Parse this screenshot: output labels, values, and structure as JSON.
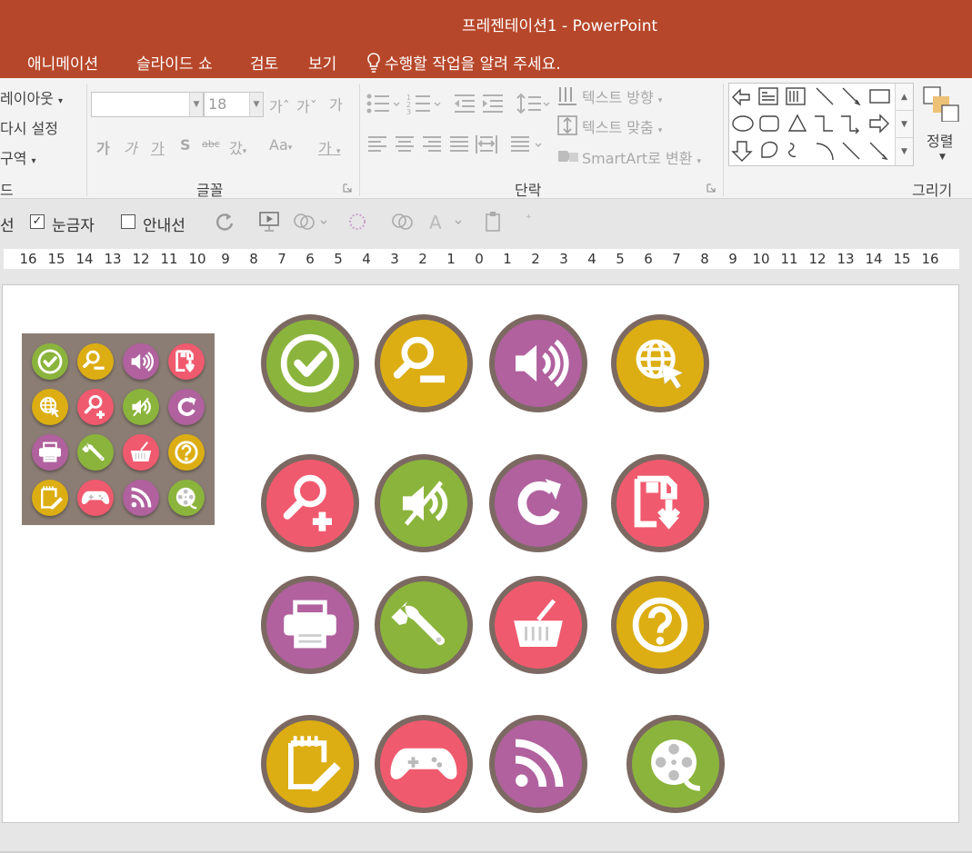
{
  "window": {
    "title": "프레젠테이션1  -  PowerPoint"
  },
  "tabs": [
    "애니메이션",
    "슬라이드 쇼",
    "검토",
    "보기"
  ],
  "tell_me": "수행할 작업을 알려 주세요.",
  "ribbon": {
    "slides_group": {
      "layout": "레이아웃",
      "reset": "다시 설정",
      "section": "구역",
      "label_fragment": "드"
    },
    "font_group": {
      "label": "글꼴",
      "font_name": "",
      "font_size": "18",
      "grow": "가ˆ",
      "shrink": "가ˇ",
      "clear": "가",
      "bold": "가",
      "italic": "가",
      "underline": "가",
      "shadow": "S",
      "strike": "abc",
      "spacing": "갔",
      "case": "Aa",
      "color": "가"
    },
    "paragraph_group": {
      "label": "단락",
      "text_direction": "텍스트 방향",
      "align_text": "텍스트 맞춤",
      "smartart": "SmartArt로 변환"
    },
    "drawing_group": {
      "label": "그리기",
      "arrange": "정렬"
    }
  },
  "view_toolbar": {
    "guides_fragment": "선",
    "gridlines": "눈금자",
    "guides": "안내선",
    "gridlines_checked": true,
    "guides_checked": false
  },
  "ruler": [
    "16",
    "15",
    "14",
    "13",
    "12",
    "11",
    "10",
    "9",
    "8",
    "7",
    "6",
    "5",
    "4",
    "3",
    "2",
    "1",
    "0",
    "1",
    "2",
    "3",
    "4",
    "5",
    "6",
    "7",
    "8",
    "9",
    "10",
    "11",
    "12",
    "13",
    "14",
    "15",
    "16"
  ],
  "colors": {
    "titlebar": "#b7472a",
    "green": "#8bb43c",
    "yellow": "#dcae13",
    "purple": "#b0619e",
    "pink": "#f05a6e",
    "ring": "#7b6962",
    "thumb_bg": "#8b7d74"
  },
  "thumbnail_icons": [
    {
      "icon": "check-icon",
      "color": "green"
    },
    {
      "icon": "zoom-out-icon",
      "color": "yellow"
    },
    {
      "icon": "volume-icon",
      "color": "purple"
    },
    {
      "icon": "save-download-icon",
      "color": "pink"
    },
    {
      "icon": "globe-cursor-icon",
      "color": "yellow"
    },
    {
      "icon": "zoom-in-icon",
      "color": "pink"
    },
    {
      "icon": "mute-icon",
      "color": "green"
    },
    {
      "icon": "refresh-icon",
      "color": "purple"
    },
    {
      "icon": "printer-icon",
      "color": "purple"
    },
    {
      "icon": "wrench-icon",
      "color": "green"
    },
    {
      "icon": "basket-icon",
      "color": "pink"
    },
    {
      "icon": "help-icon",
      "color": "yellow"
    },
    {
      "icon": "notepad-icon",
      "color": "yellow"
    },
    {
      "icon": "gamepad-icon",
      "color": "pink"
    },
    {
      "icon": "rss-icon",
      "color": "purple"
    },
    {
      "icon": "film-reel-icon",
      "color": "green"
    }
  ],
  "slide_icons": [
    {
      "icon": "check-icon",
      "color": "green"
    },
    {
      "icon": "zoom-out-icon",
      "color": "yellow"
    },
    {
      "icon": "volume-icon",
      "color": "purple"
    },
    {
      "icon": "globe-cursor-icon",
      "color": "yellow"
    },
    {
      "icon": "zoom-in-icon",
      "color": "pink"
    },
    {
      "icon": "mute-icon",
      "color": "green"
    },
    {
      "icon": "refresh-icon",
      "color": "purple"
    },
    {
      "icon": "save-download-icon",
      "color": "pink"
    },
    {
      "icon": "printer-icon",
      "color": "purple"
    },
    {
      "icon": "wrench-icon",
      "color": "green"
    },
    {
      "icon": "basket-icon",
      "color": "pink"
    },
    {
      "icon": "help-icon",
      "color": "yellow"
    },
    {
      "icon": "notepad-icon",
      "color": "yellow"
    },
    {
      "icon": "gamepad-icon",
      "color": "pink"
    },
    {
      "icon": "rss-icon",
      "color": "purple"
    },
    {
      "icon": "film-reel-icon",
      "color": "green"
    }
  ]
}
